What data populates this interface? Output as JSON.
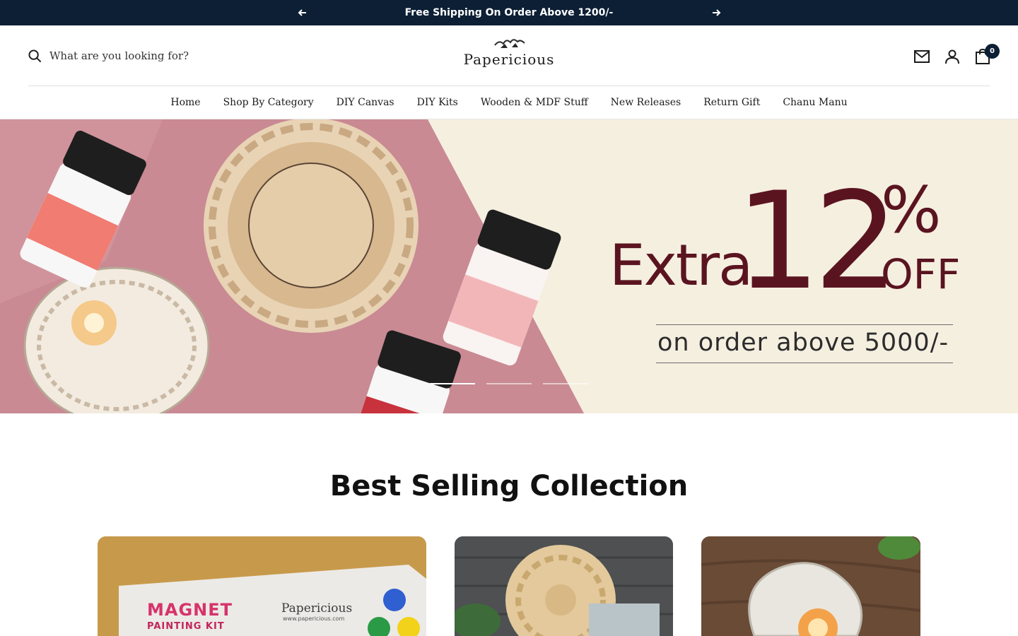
{
  "announcement": {
    "text": "Free Shipping On Order Above 1200/-",
    "prev_icon": "arrow-left-icon",
    "next_icon": "arrow-right-icon"
  },
  "header": {
    "search_placeholder": "What are you looking for?",
    "logo_text": "Papericious",
    "cart_count": "0",
    "icons": [
      "search-icon",
      "mail-icon",
      "account-icon",
      "cart-icon"
    ]
  },
  "nav": {
    "items": [
      {
        "label": "Home"
      },
      {
        "label": "Shop By Category"
      },
      {
        "label": "DIY Canvas"
      },
      {
        "label": "DIY Kits"
      },
      {
        "label": "Wooden & MDF Stuff"
      },
      {
        "label": "New Releases"
      },
      {
        "label": "Return Gift"
      },
      {
        "label": "Chanu Manu"
      }
    ]
  },
  "hero": {
    "extra": "Extra",
    "number": "12",
    "percent": "%",
    "off": "OFF",
    "subtext": "on order above 5000/-",
    "slide_count": 3,
    "active_slide": 1
  },
  "collection": {
    "title": "Best Selling Collection",
    "cards": [
      {
        "kit_title": "MAGNET",
        "kit_subtitle": "PAINTING KIT",
        "brand": "Papericious",
        "url": "www.papericious.com"
      },
      {},
      {}
    ]
  },
  "colors": {
    "announcement_bg": "#0c1f35",
    "offer_text": "#5a1420",
    "hero_pink": "#c98a93",
    "hero_cream": "#f5efe0"
  }
}
